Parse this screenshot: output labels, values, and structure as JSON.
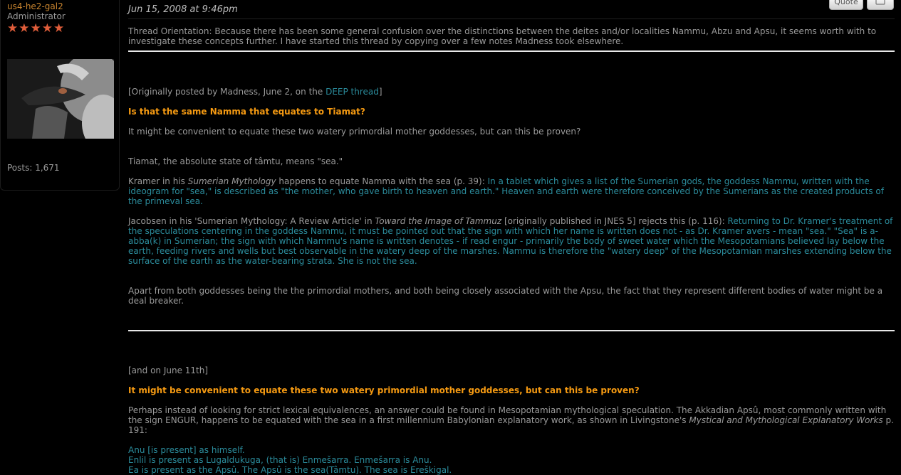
{
  "sidebar": {
    "username": "us4-he2-gal2",
    "role": "Administrator",
    "stars": "★★★★★",
    "posts": "Posts: 1,671"
  },
  "post": {
    "date": "Jun 15, 2008 at 9:46pm",
    "quote_label": "Quote",
    "intro": "Thread Orientation: Because there has been some general confusion over the distinctions between the deites and/or localities Nammu, Abzu and Apsu, it seems worth with to investigate these concepts further. I have started this thread by copying over a few notes Madness took elsewhere.",
    "orig_prefix": "[Originally posted by Madness, June 2, on the ",
    "orig_link": "DEEP thread",
    "orig_suffix": "]",
    "heading1": "Is that the same Namma that equates to Tiamat?",
    "para1": "It might be convenient to equate these two watery primordial mother goddesses, but can this be proven?",
    "para2": "Tiamat, the absolute state of tâmtu, means \"sea.\"",
    "kramer_a": "Kramer in his ",
    "kramer_title": "Sumerian Mythology",
    "kramer_b": " happens to equate Namma with the sea (p. 39): ",
    "kramer_quote": "In a tablet which gives a list of the Sumerian gods, the goddess Nammu, written with the ideogram for \"sea,\" is described as \"the mother, who gave birth to heaven and earth.\" Heaven and earth were therefore conceived by the Sumerians as the created products of the primeval sea.",
    "jacobsen_a": "Jacobsen in his 'Sumerian Mythology: A Review Article' in ",
    "jacobsen_title": "Toward the Image of Tammuz",
    "jacobsen_b": " [originally published in JNES 5] rejects this (p. 116): ",
    "jacobsen_quote": "Returning to Dr. Kramer's treatment of the speculations centering in the goddess Nammu, it must be pointed out that the sign with which her name is written does not - as Dr. Kramer avers - mean \"sea.\" \"Sea\" is a-abba(k) in Sumerian; the sign with which Nammu's name is written denotes - if read engur - primarily the body of sweet water which the Mesopotamians believed lay below the earth, feeding rivers and wells but best observable in the watery deep of the marshes. Nammu is therefore the \"watery deep\" of the Mesopotamian marshes extending below the surface of the earth as the water-bearing strata. She is not the sea.",
    "para_apart": "Apart from both goddesses being the the primordial mothers, and both being closely associated with the Apsu, the fact that they represent different bodies of water might be a deal breaker.",
    "june11": "[and on June 11th]",
    "heading2": "It might be convenient to equate these two watery primordial mother goddesses, but can this be proven?",
    "perhaps_a": "Perhaps instead of looking for strict lexical equivalences, an answer could be found in Mesopotamian mythological speculation. The Akkadian Apsû, most commonly written with the sign ENGUR, happens to be equated with the sea in a first millennium Babylonian explanatory work, as shown in Livingstone's ",
    "perhaps_title": "Mystical and Mythological Explanatory Works",
    "perhaps_b": " p. 191:",
    "line1": "Anu [is present] as himself.",
    "line2": "Enlil is present as Lugaldukuga, (that is) Enmešarra. Enmešarra is Anu.",
    "line3": "Ea is present as the Apsû. The Apsû is the sea(Tâmtu). The sea is Ereškigal."
  },
  "icons": {
    "avatar": "user-avatar-photo",
    "multi_quote": "multi-quote-icon"
  }
}
